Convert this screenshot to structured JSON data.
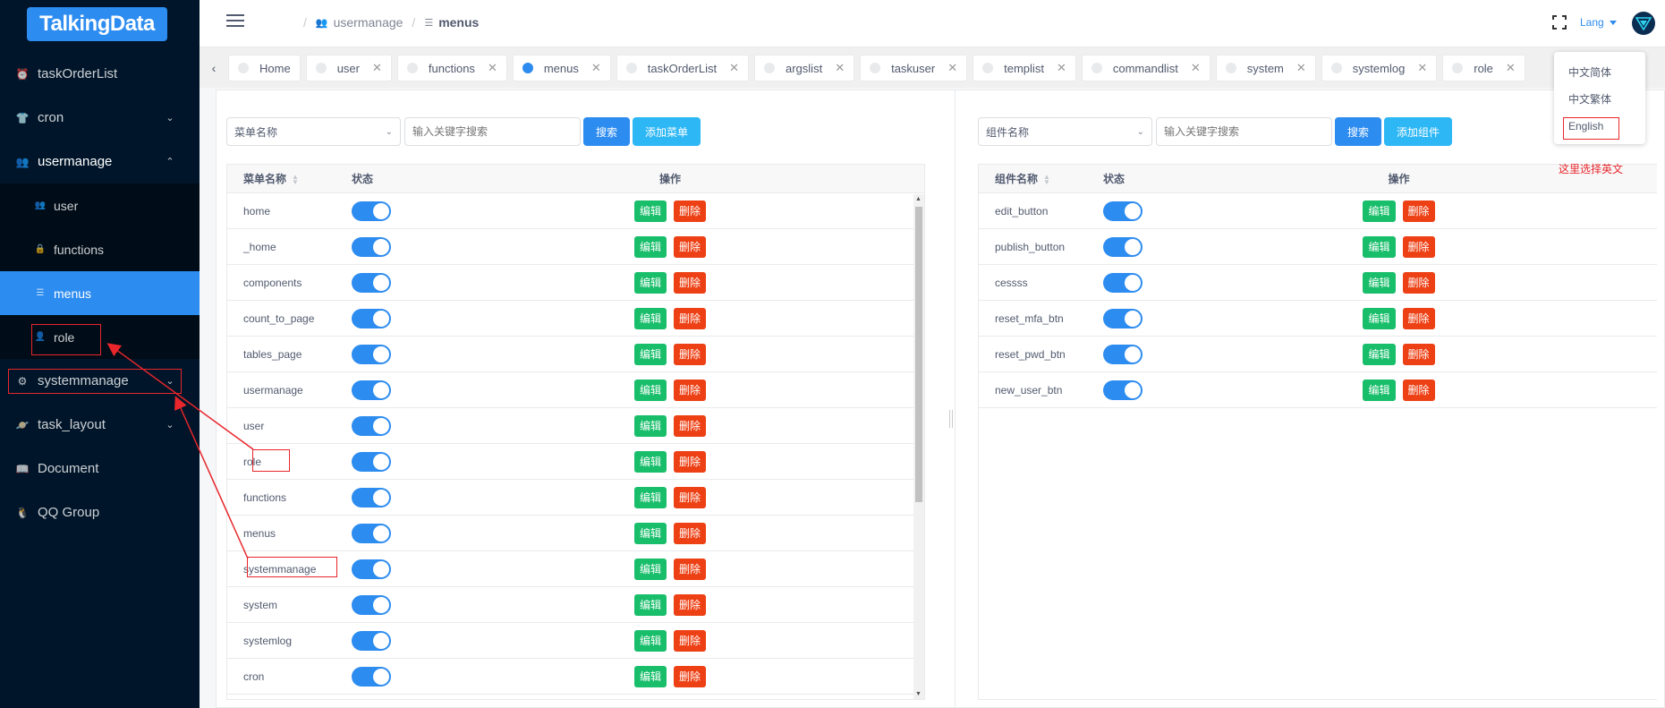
{
  "app": {
    "logo_text": "TalkingData",
    "brand_color": "#2d8cf0"
  },
  "sidebar": {
    "items": [
      {
        "label": "taskOrderList",
        "icon": "alarm-clock-icon"
      },
      {
        "label": "cron",
        "icon": "shirt-icon"
      },
      {
        "label": "usermanage",
        "icon": "people-icon"
      },
      {
        "label": "systemmanage",
        "icon": "gear-icon"
      },
      {
        "label": "task_layout",
        "icon": "planet-icon"
      },
      {
        "label": "Document",
        "icon": "book-icon"
      },
      {
        "label": "QQ Group",
        "icon": "qq-icon"
      }
    ],
    "sub_items": [
      {
        "label": "user",
        "icon": "people-icon"
      },
      {
        "label": "functions",
        "icon": "lock-icon"
      },
      {
        "label": "menus",
        "icon": "list-icon"
      },
      {
        "label": "role",
        "icon": "person-icon"
      }
    ]
  },
  "header": {
    "breadcrumb": [
      "usermanage",
      "menus"
    ],
    "lang_label": "Lang"
  },
  "tabs": [
    "Home",
    "user",
    "functions",
    "menus",
    "taskOrderList",
    "argslist",
    "taskuser",
    "templist",
    "commandlist",
    "system",
    "systemlog",
    "role"
  ],
  "lang_dropdown": {
    "options": [
      "中文简体",
      "中文繁体",
      "English"
    ]
  },
  "left_panel": {
    "select_value": "菜单名称",
    "search_placeholder": "输入关键字搜索",
    "search_label": "搜索",
    "add_label": "添加菜单",
    "columns": [
      "菜单名称",
      "状态",
      "操作"
    ],
    "rows": [
      "home",
      "_home",
      "components",
      "count_to_page",
      "tables_page",
      "usermanage",
      "user",
      "role",
      "functions",
      "menus",
      "systemmanage",
      "system",
      "systemlog",
      "cron"
    ]
  },
  "right_panel": {
    "select_value": "组件名称",
    "search_placeholder": "输入关键字搜索",
    "search_label": "搜索",
    "add_label": "添加组件",
    "columns": [
      "组件名称",
      "状态",
      "操作"
    ],
    "rows": [
      "edit_button",
      "publish_button",
      "cessss",
      "reset_mfa_btn",
      "reset_pwd_btn",
      "new_user_btn"
    ]
  },
  "row_actions": {
    "edit": "编辑",
    "delete": "删除"
  },
  "annotation": {
    "note": "这里选择英文",
    "color": "#e8262b"
  }
}
